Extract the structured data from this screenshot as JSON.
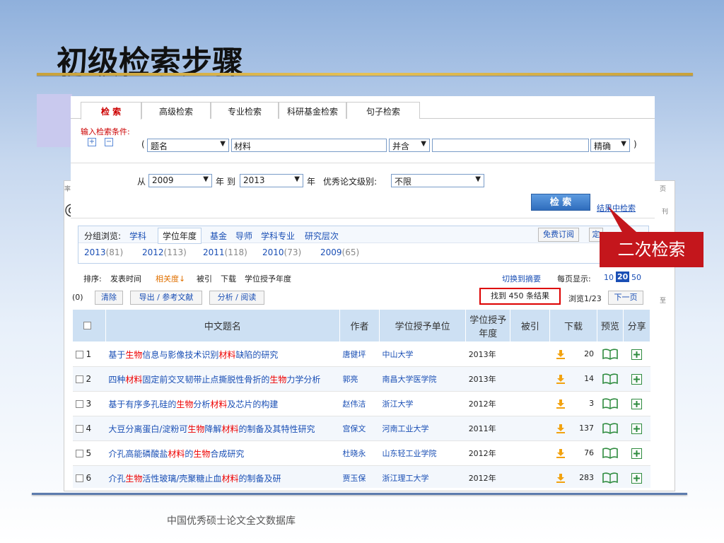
{
  "slide": {
    "title": "初级检索步骤",
    "footer": "中国优秀硕士论文全文数据库",
    "callout": "二次检索"
  },
  "tabs": [
    "检 索",
    "高级检索",
    "专业检索",
    "科研基金检索",
    "句子检索"
  ],
  "form": {
    "condition_label": "输入检索条件:",
    "open_paren": "(",
    "field_select": "题名",
    "keyword": "材料",
    "and_select": "并含",
    "second_keyword": "",
    "match_select": "精确",
    "close_paren": ")",
    "from_label": "从",
    "from_year": "2009",
    "year_label_1": "年 到",
    "to_year": "2013",
    "year_label_2": "年",
    "excellence_label": "优秀论文级别:",
    "excellence_select": "不限",
    "search_button": "检 索",
    "secondary_search_link": "结果中检索"
  },
  "group_browse": {
    "label": "分组浏览:",
    "tabs": [
      "学科",
      "学位年度",
      "基金",
      "导师",
      "学科专业",
      "研究层次"
    ],
    "subscribe": "免费订阅",
    "subscribe_2": "定",
    "years": [
      {
        "year": "2013",
        "count": "(81)"
      },
      {
        "year": "2012",
        "count": "(113)"
      },
      {
        "year": "2011",
        "count": "(118)"
      },
      {
        "year": "2010",
        "count": "(73)"
      },
      {
        "year": "2009",
        "count": "(65)"
      }
    ]
  },
  "sort": {
    "label": "排序:",
    "options": [
      "发表时间",
      "相关度↓",
      "被引",
      "下载",
      "学位授予年度"
    ],
    "switch_view": "切换到摘要",
    "per_page_label": "每页显示:",
    "per_page": [
      "10",
      "20",
      "50"
    ]
  },
  "actions": {
    "selected": "(0)",
    "clear": "清除",
    "export": "导出 / 参考文献",
    "analyze": "分析 / 阅读",
    "results_count": "找到 450 条结果",
    "page_info": "浏览1/23",
    "next_page": "下一页"
  },
  "table": {
    "headers": [
      "中文题名",
      "作者",
      "学位授予单位",
      "学位授予年度",
      "被引",
      "下载",
      "预览",
      "分享"
    ],
    "rows": [
      {
        "n": "1",
        "title": [
          [
            "基于",
            ""
          ],
          [
            "生物",
            "hl"
          ],
          [
            "信息与影像技术识别",
            ""
          ],
          [
            "材料",
            "hl"
          ],
          [
            "缺陷的研究",
            ""
          ]
        ],
        "author": "唐健坪",
        "unit": "中山大学",
        "year": "2013年",
        "cited": "",
        "downloads": "20"
      },
      {
        "n": "2",
        "title": [
          [
            "四种",
            ""
          ],
          [
            "材料",
            "hl"
          ],
          [
            "固定前交叉韧带止点撕脱性骨折的",
            ""
          ],
          [
            "生物",
            "hl"
          ],
          [
            "力学分析",
            ""
          ]
        ],
        "author": "郭亮",
        "unit": "南昌大学医学院",
        "year": "2013年",
        "cited": "",
        "downloads": "14"
      },
      {
        "n": "3",
        "title": [
          [
            "基于有序多孔硅的",
            ""
          ],
          [
            "生物",
            "hl"
          ],
          [
            "分析",
            ""
          ],
          [
            "材料",
            "hl"
          ],
          [
            "及芯片的构建",
            ""
          ]
        ],
        "author": "赵伟洁",
        "unit": "浙江大学",
        "year": "2012年",
        "cited": "",
        "downloads": "3"
      },
      {
        "n": "4",
        "title": [
          [
            "大豆分离蛋白/淀粉可",
            ""
          ],
          [
            "生物",
            "hl"
          ],
          [
            "降解",
            ""
          ],
          [
            "材料",
            "hl"
          ],
          [
            "的制备及其特性研究",
            ""
          ]
        ],
        "author": "宫保文",
        "unit": "河南工业大学",
        "year": "2011年",
        "cited": "",
        "downloads": "137"
      },
      {
        "n": "5",
        "title": [
          [
            "介孔高能磷酸盐",
            ""
          ],
          [
            "材料",
            "hl"
          ],
          [
            "的",
            ""
          ],
          [
            "生物",
            "hl"
          ],
          [
            "合成研究",
            ""
          ]
        ],
        "author": "杜晓永",
        "unit": "山东轻工业学院",
        "year": "2012年",
        "cited": "",
        "downloads": "76"
      },
      {
        "n": "6",
        "title": [
          [
            "介孔",
            ""
          ],
          [
            "生物",
            "hl"
          ],
          [
            "活性玻璃/壳聚糖止血",
            ""
          ],
          [
            "材料",
            "hl"
          ],
          [
            "的制备及研",
            ""
          ]
        ],
        "author": "贾玉保",
        "unit": "浙江理工大学",
        "year": "2012年",
        "cited": "",
        "downloads": "283"
      }
    ]
  },
  "icons": {
    "download": "download-arrow-icon",
    "preview": "book-icon",
    "share": "plus-icon"
  },
  "colors": {
    "highlight": "#e00000",
    "link": "#1a4fb5",
    "callout": "#c4161c",
    "title_rule": "#d4aa40"
  }
}
